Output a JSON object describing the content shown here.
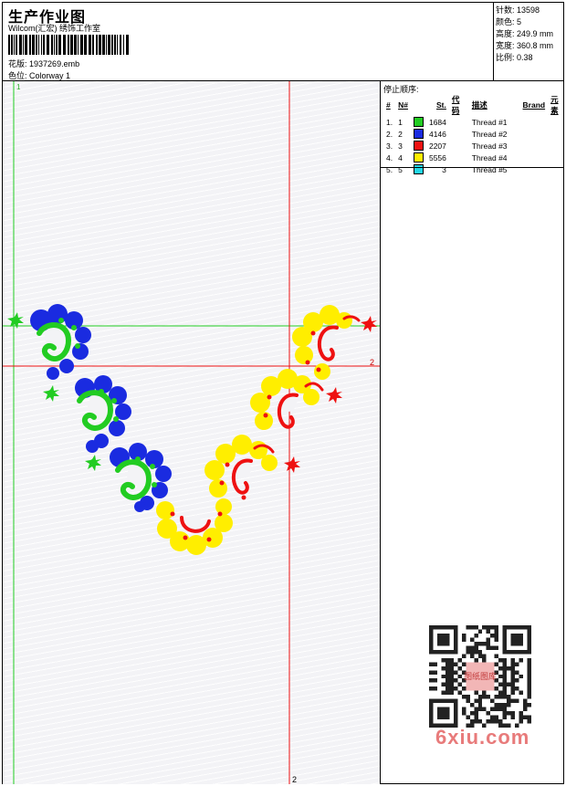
{
  "header": {
    "title": "生产作业图",
    "company": "Wilcom(汇宏) 绣饰工作室",
    "design_label": "花版:",
    "design_value": "1937269.emb",
    "colorway_label": "色位:",
    "colorway_value": "Colorway 1"
  },
  "stats": [
    {
      "label": "针数:",
      "value": "13598"
    },
    {
      "label": "颜色:",
      "value": "5"
    },
    {
      "label": "高度:",
      "value": "249.9 mm"
    },
    {
      "label": "宽度:",
      "value": "360.8 mm"
    },
    {
      "label": "比例:",
      "value": "0.38"
    }
  ],
  "stop_sequence": {
    "title": "停止顺序:",
    "columns": [
      "#",
      "N#",
      "St.",
      "代码",
      "描述",
      "Brand",
      "元素"
    ],
    "rows": [
      {
        "num": "1.",
        "n": "1",
        "color": "#22cc22",
        "stitches": "1684",
        "desc": "Thread #1"
      },
      {
        "num": "2.",
        "n": "2",
        "color": "#1a2be0",
        "stitches": "4146",
        "desc": "Thread #2"
      },
      {
        "num": "3.",
        "n": "3",
        "color": "#ee1111",
        "stitches": "2207",
        "desc": "Thread #3"
      },
      {
        "num": "4.",
        "n": "4",
        "color": "#ffee00",
        "stitches": "5556",
        "desc": "Thread #4"
      },
      {
        "num": "5.",
        "n": "5",
        "color": "#22d8e8",
        "stitches": "3",
        "desc": "Thread #5"
      }
    ]
  },
  "guides": {
    "green_label": "1",
    "red_label_right": "2",
    "red_label_bottom": "2"
  },
  "watermark": "6xiu.com",
  "stamp_text": "图纸图库"
}
